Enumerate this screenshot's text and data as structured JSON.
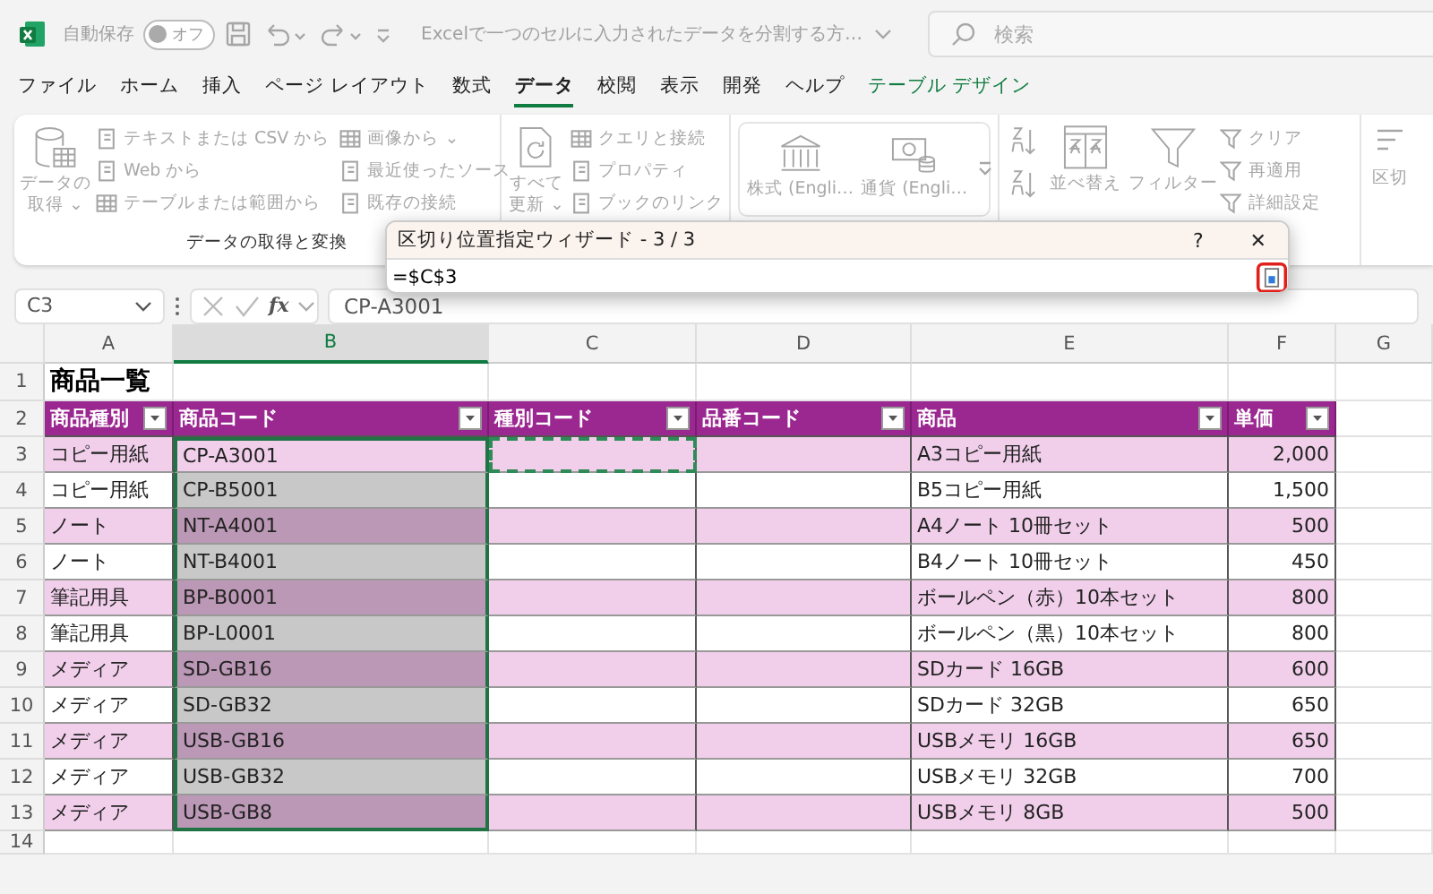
{
  "title_bar": {
    "autosave_label": "自動保存",
    "autosave_toggle": {
      "label": "オフ",
      "on": false
    },
    "doc_title": "Excelで一つのセルに入力されたデータを分割する方…",
    "search_placeholder": "検索"
  },
  "menu_tabs": [
    {
      "label": "ファイル",
      "selected": false
    },
    {
      "label": "ホーム",
      "selected": false
    },
    {
      "label": "挿入",
      "selected": false
    },
    {
      "label": "ページ レイアウト",
      "selected": false
    },
    {
      "label": "数式",
      "selected": false
    },
    {
      "label": "データ",
      "selected": true
    },
    {
      "label": "校閲",
      "selected": false
    },
    {
      "label": "表示",
      "selected": false
    },
    {
      "label": "開発",
      "selected": false
    },
    {
      "label": "ヘルプ",
      "selected": false
    },
    {
      "label": "テーブル デザイン",
      "selected": false,
      "kind": "contextual"
    }
  ],
  "ribbon": {
    "get_data": {
      "big_button": [
        "データの",
        "取得 ⌄"
      ],
      "col1": [
        "テキストまたは CSV から",
        "Web から",
        "テーブルまたは範囲から"
      ],
      "col2": [
        "画像から ⌄",
        "最近使ったソース",
        "既存の接続"
      ],
      "label": "データの取得と変換"
    },
    "queries": {
      "big_button": [
        "すべて",
        "更新 ⌄"
      ],
      "items": [
        "クエリと接続",
        "プロパティ",
        "ブックのリンク"
      ]
    },
    "data_types": {
      "items": [
        "株式 (Engli…",
        "通貨 (Engli…"
      ]
    },
    "sort_filter": {
      "sort_label": "並べ替え",
      "filter_label": "フィルター",
      "items": [
        "クリア",
        "再適用",
        "詳細設定"
      ]
    },
    "cut_label": "区切"
  },
  "dialog": {
    "title": "区切り位置指定ウィザード - 3 / 3",
    "help": "?",
    "close": "✕",
    "value": "=$C$3"
  },
  "formula_bar": {
    "name_box": "C3",
    "fx": "fx",
    "formula": "CP-A3001"
  },
  "columns": [
    {
      "label": "A",
      "selected": false
    },
    {
      "label": "B",
      "selected": true
    },
    {
      "label": "C",
      "selected": false
    },
    {
      "label": "D",
      "selected": false
    },
    {
      "label": "E",
      "selected": false
    },
    {
      "label": "F",
      "selected": false
    },
    {
      "label": "G",
      "selected": false
    }
  ],
  "sheet_title": "商品一覧",
  "table_headers": [
    "商品種別",
    "商品コード",
    "種別コード",
    "品番コード",
    "商品",
    "単価"
  ],
  "rows": [
    {
      "category": "コピー用紙",
      "code": "CP-A3001",
      "product": "A3コピー用紙",
      "price": "2,000",
      "selected": true,
      "active": true,
      "marquee": true
    },
    {
      "category": "コピー用紙",
      "code": "CP-B5001",
      "product": "B5コピー用紙",
      "price": "1,500",
      "selected": true,
      "active": false,
      "marquee": false
    },
    {
      "category": "ノート",
      "code": "NT-A4001",
      "product": "A4ノート 10冊セット",
      "price": "500",
      "selected": true,
      "active": false,
      "marquee": false
    },
    {
      "category": "ノート",
      "code": "NT-B4001",
      "product": "B4ノート 10冊セット",
      "price": "450",
      "selected": true,
      "active": false,
      "marquee": false
    },
    {
      "category": "筆記用具",
      "code": "BP-B0001",
      "product": "ボールペン（赤）10本セット",
      "price": "800",
      "selected": true,
      "active": false,
      "marquee": false
    },
    {
      "category": "筆記用具",
      "code": "BP-L0001",
      "product": "ボールペン（黒）10本セット",
      "price": "800",
      "selected": true,
      "active": false,
      "marquee": false
    },
    {
      "category": "メディア",
      "code": "SD-GB16",
      "product": "SDカード 16GB",
      "price": "600",
      "selected": true,
      "active": false,
      "marquee": false
    },
    {
      "category": "メディア",
      "code": "SD-GB32",
      "product": "SDカード 32GB",
      "price": "650",
      "selected": true,
      "active": false,
      "marquee": false
    },
    {
      "category": "メディア",
      "code": "USB-GB16",
      "product": "USBメモリ 16GB",
      "price": "650",
      "selected": true,
      "active": false,
      "marquee": false
    },
    {
      "category": "メディア",
      "code": "USB-GB32",
      "product": "USBメモリ 32GB",
      "price": "700",
      "selected": true,
      "active": false,
      "marquee": false
    },
    {
      "category": "メディア",
      "code": "USB-GB8",
      "product": "USBメモリ  8GB",
      "price": "500",
      "selected": true,
      "active": false,
      "marquee": false
    }
  ],
  "row_numbers": [
    "1",
    "2",
    "3",
    "4",
    "5",
    "6",
    "7",
    "8",
    "9",
    "10",
    "11",
    "12",
    "13",
    "14"
  ]
}
